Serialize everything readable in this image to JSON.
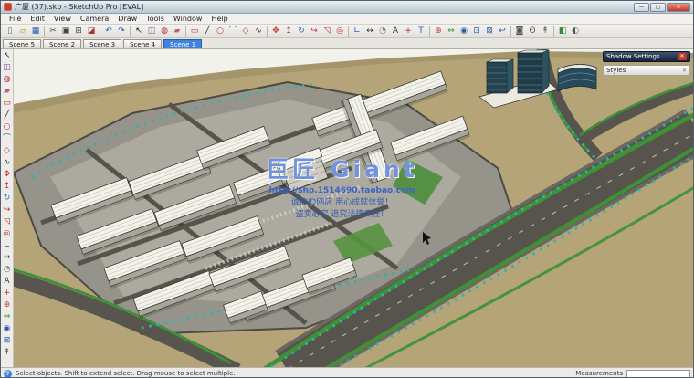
{
  "window": {
    "title": "广厦 (37).skp - SketchUp Pro [EVAL]",
    "buttons": {
      "minimize": "—",
      "maximize": "▢",
      "close": "✕"
    },
    "app_icon": "sketchup-logo-icon"
  },
  "menu": {
    "items": [
      "File",
      "Edit",
      "View",
      "Camera",
      "Draw",
      "Tools",
      "Window",
      "Help"
    ]
  },
  "toolbar": {
    "icons": [
      {
        "name": "new-file-icon",
        "glyph": "▯",
        "color": "#666"
      },
      {
        "name": "open-icon",
        "glyph": "▱",
        "color": "#b8860b"
      },
      {
        "name": "save-icon",
        "glyph": "▦",
        "color": "#2a5db0"
      },
      {
        "sep": true
      },
      {
        "name": "cut-icon",
        "glyph": "✂",
        "color": "#444"
      },
      {
        "name": "copy-icon",
        "glyph": "▣",
        "color": "#444"
      },
      {
        "name": "paste-icon",
        "glyph": "⊞",
        "color": "#444"
      },
      {
        "name": "erase-icon",
        "glyph": "◪",
        "color": "#a33333"
      },
      {
        "sep": true
      },
      {
        "name": "undo-icon",
        "glyph": "↶",
        "color": "#2a5db0"
      },
      {
        "name": "redo-icon",
        "glyph": "↷",
        "color": "#2a5db0"
      },
      {
        "sep": true
      },
      {
        "name": "select-icon",
        "glyph": "↖",
        "color": "#111"
      },
      {
        "name": "make-component-icon",
        "glyph": "◫",
        "color": "#7a4fa0"
      },
      {
        "name": "paint-bucket-icon",
        "glyph": "◍",
        "color": "#b03030"
      },
      {
        "name": "eraser-icon",
        "glyph": "▰",
        "color": "#c06080"
      },
      {
        "sep": true
      },
      {
        "name": "rectangle-icon",
        "glyph": "▭",
        "color": "#b03030"
      },
      {
        "name": "line-icon",
        "glyph": "╱",
        "color": "#222"
      },
      {
        "name": "circle-icon",
        "glyph": "○",
        "color": "#b03030"
      },
      {
        "name": "arc-icon",
        "glyph": "⌒",
        "color": "#2a5db0"
      },
      {
        "name": "polygon-icon",
        "glyph": "◇",
        "color": "#b03030"
      },
      {
        "name": "freehand-icon",
        "glyph": "∿",
        "color": "#222"
      },
      {
        "sep": true
      },
      {
        "name": "move-icon",
        "glyph": "✥",
        "color": "#c03030"
      },
      {
        "name": "push-pull-icon",
        "glyph": "↥",
        "color": "#c03030"
      },
      {
        "name": "rotate-icon",
        "glyph": "↻",
        "color": "#2a5db0"
      },
      {
        "name": "follow-me-icon",
        "glyph": "↪",
        "color": "#c03030"
      },
      {
        "name": "scale-icon",
        "glyph": "◹",
        "color": "#c03030"
      },
      {
        "name": "offset-icon",
        "glyph": "◎",
        "color": "#c03030"
      },
      {
        "sep": true
      },
      {
        "name": "tape-measure-icon",
        "glyph": "∟",
        "color": "#2a5db0"
      },
      {
        "name": "dimension-icon",
        "glyph": "↔",
        "color": "#333"
      },
      {
        "name": "protractor-icon",
        "glyph": "◔",
        "color": "#777"
      },
      {
        "name": "text-icon",
        "glyph": "A",
        "color": "#333"
      },
      {
        "name": "axes-icon",
        "glyph": "+",
        "color": "#b03030"
      },
      {
        "name": "3d-text-icon",
        "glyph": "T",
        "color": "#2a5db0"
      },
      {
        "sep": true
      },
      {
        "name": "orbit-icon",
        "glyph": "⊕",
        "color": "#c04040"
      },
      {
        "name": "pan-icon",
        "glyph": "⇔",
        "color": "#3a8a3a"
      },
      {
        "name": "zoom-icon",
        "glyph": "◉",
        "color": "#2a5db0"
      },
      {
        "name": "zoom-window-icon",
        "glyph": "⊡",
        "color": "#2a5db0"
      },
      {
        "name": "zoom-extents-icon",
        "glyph": "⊠",
        "color": "#2a5db0"
      },
      {
        "name": "previous-view-icon",
        "glyph": "↩",
        "color": "#2a5db0"
      },
      {
        "sep": true
      },
      {
        "name": "position-camera-icon",
        "glyph": "◙",
        "color": "#555"
      },
      {
        "name": "look-around-icon",
        "glyph": "ʘ",
        "color": "#555"
      },
      {
        "name": "walk-icon",
        "glyph": "↟",
        "color": "#555"
      },
      {
        "sep": true
      },
      {
        "name": "section-plane-icon",
        "glyph": "◧",
        "color": "#3a8a3a"
      },
      {
        "name": "shadows-icon",
        "glyph": "◐",
        "color": "#555"
      }
    ]
  },
  "left_toolbar": {
    "icons": [
      {
        "name": "select-icon",
        "glyph": "↖",
        "color": "#111"
      },
      {
        "name": "make-component-icon",
        "glyph": "◫",
        "color": "#7a4fa0"
      },
      {
        "name": "paint-bucket-icon",
        "glyph": "◍",
        "color": "#b03030"
      },
      {
        "name": "eraser-icon",
        "glyph": "▰",
        "color": "#c06080"
      },
      {
        "name": "rectangle-icon",
        "glyph": "▭",
        "color": "#b03030"
      },
      {
        "name": "line-icon",
        "glyph": "╱",
        "color": "#222"
      },
      {
        "name": "circle-icon",
        "glyph": "○",
        "color": "#b03030"
      },
      {
        "name": "arc-icon",
        "glyph": "⌒",
        "color": "#2a5db0"
      },
      {
        "name": "polygon-icon",
        "glyph": "◇",
        "color": "#b03030"
      },
      {
        "name": "freehand-icon",
        "glyph": "∿",
        "color": "#222"
      },
      {
        "name": "move-icon",
        "glyph": "✥",
        "color": "#c03030"
      },
      {
        "name": "push-pull-icon",
        "glyph": "↥",
        "color": "#c03030"
      },
      {
        "name": "rotate-icon",
        "glyph": "↻",
        "color": "#2a5db0"
      },
      {
        "name": "follow-me-icon",
        "glyph": "↪",
        "color": "#c03030"
      },
      {
        "name": "scale-icon",
        "glyph": "◹",
        "color": "#c03030"
      },
      {
        "name": "offset-icon",
        "glyph": "◎",
        "color": "#c03030"
      },
      {
        "name": "tape-measure-icon",
        "glyph": "∟",
        "color": "#2a5db0"
      },
      {
        "name": "dimension-icon",
        "glyph": "↔",
        "color": "#333"
      },
      {
        "name": "protractor-icon",
        "glyph": "◔",
        "color": "#777"
      },
      {
        "name": "text-icon",
        "glyph": "A",
        "color": "#333"
      },
      {
        "name": "axes-icon",
        "glyph": "+",
        "color": "#b03030"
      },
      {
        "name": "orbit-icon",
        "glyph": "⊕",
        "color": "#c04040"
      },
      {
        "name": "pan-icon",
        "glyph": "⇔",
        "color": "#3a8a3a"
      },
      {
        "name": "zoom-icon",
        "glyph": "◉",
        "color": "#2a5db0"
      },
      {
        "name": "zoom-extents-icon",
        "glyph": "⊠",
        "color": "#2a5db0"
      },
      {
        "name": "walk-icon",
        "glyph": "↟",
        "color": "#555"
      }
    ]
  },
  "scene_tabs": {
    "tabs": [
      "Scene 5",
      "Scene 2",
      "Scene 3",
      "Scene 4",
      "Scene 1"
    ],
    "selected": "Scene 1"
  },
  "panels": {
    "shadow_settings": {
      "title": "Shadow Settings",
      "close": "✕"
    },
    "styles": {
      "title": "Styles",
      "close": "✕"
    }
  },
  "watermark": {
    "line1": "巨匠 Giant",
    "line2": "http://shp.1514690.taobao.com",
    "line3": "诚信ID网店 用心成就信誉！",
    "line4": "盗卖必究 追究法律责任！"
  },
  "statusbar": {
    "help_icon": "help-circle-icon",
    "hint": "Select objects. Shift to extend select. Drag mouse to select multiple.",
    "measurements_label": "Measurements",
    "measurements_value": ""
  }
}
